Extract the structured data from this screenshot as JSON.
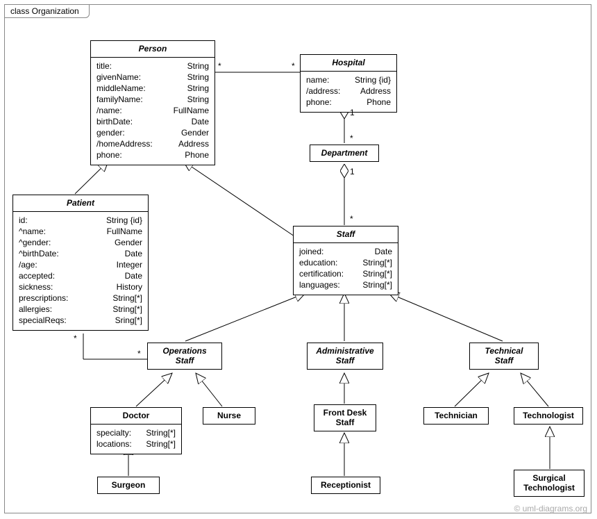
{
  "frame": {
    "title": "class Organization"
  },
  "watermark": "© uml-diagrams.org",
  "mult": {
    "person_hospital_left": "*",
    "person_hospital_right": "*",
    "hospital_dept_top": "1",
    "hospital_dept_bottom": "*",
    "dept_staff_top": "1",
    "dept_staff_bottom": "*",
    "patient_ops_left": "*",
    "patient_ops_right": "*"
  },
  "classes": {
    "person": {
      "name": "Person",
      "attrs": [
        {
          "n": "title:",
          "t": "String"
        },
        {
          "n": "givenName:",
          "t": "String"
        },
        {
          "n": "middleName:",
          "t": "String"
        },
        {
          "n": "familyName:",
          "t": "String"
        },
        {
          "n": "/name:",
          "t": "FullName"
        },
        {
          "n": "birthDate:",
          "t": "Date"
        },
        {
          "n": "gender:",
          "t": "Gender"
        },
        {
          "n": "/homeAddress:",
          "t": "Address"
        },
        {
          "n": "phone:",
          "t": "Phone"
        }
      ]
    },
    "hospital": {
      "name": "Hospital",
      "attrs": [
        {
          "n": "name:",
          "t": "String {id}"
        },
        {
          "n": "/address:",
          "t": "Address"
        },
        {
          "n": "phone:",
          "t": "Phone"
        }
      ]
    },
    "department": {
      "name": "Department"
    },
    "patient": {
      "name": "Patient",
      "attrs": [
        {
          "n": "id:",
          "t": "String {id}"
        },
        {
          "n": "^name:",
          "t": "FullName"
        },
        {
          "n": "^gender:",
          "t": "Gender"
        },
        {
          "n": "^birthDate:",
          "t": "Date"
        },
        {
          "n": "/age:",
          "t": "Integer"
        },
        {
          "n": "accepted:",
          "t": "Date"
        },
        {
          "n": "sickness:",
          "t": "History"
        },
        {
          "n": "prescriptions:",
          "t": "String[*]"
        },
        {
          "n": "allergies:",
          "t": "String[*]"
        },
        {
          "n": "specialReqs:",
          "t": "Sring[*]"
        }
      ]
    },
    "staff": {
      "name": "Staff",
      "attrs": [
        {
          "n": "joined:",
          "t": "Date"
        },
        {
          "n": "education:",
          "t": "String[*]"
        },
        {
          "n": "certification:",
          "t": "String[*]"
        },
        {
          "n": "languages:",
          "t": "String[*]"
        }
      ]
    },
    "ops": {
      "name": "Operations",
      "name2": "Staff"
    },
    "admin": {
      "name": "Administrative",
      "name2": "Staff"
    },
    "tech": {
      "name": "Technical",
      "name2": "Staff"
    },
    "doctor": {
      "name": "Doctor",
      "attrs": [
        {
          "n": "specialty:",
          "t": "String[*]"
        },
        {
          "n": "locations:",
          "t": "String[*]"
        }
      ]
    },
    "nurse": {
      "name": "Nurse"
    },
    "frontdesk": {
      "name": "Front Desk",
      "name2": "Staff"
    },
    "technician": {
      "name": "Technician"
    },
    "technologist": {
      "name": "Technologist"
    },
    "surgeon": {
      "name": "Surgeon"
    },
    "receptionist": {
      "name": "Receptionist"
    },
    "surgtech": {
      "name": "Surgical",
      "name2": "Technologist"
    }
  }
}
